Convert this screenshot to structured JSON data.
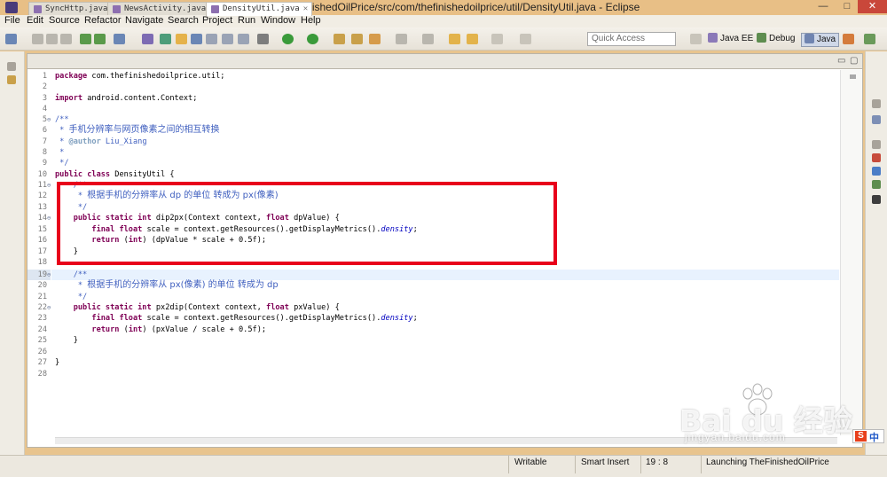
{
  "window": {
    "title": "Java - TheFinishedOilPrice/src/com/thefinishedoilprice/util/DensityUtil.java - Eclipse"
  },
  "menu": [
    "File",
    "Edit",
    "Source",
    "Refactor",
    "Navigate",
    "Search",
    "Project",
    "Run",
    "Window",
    "Help"
  ],
  "toolbar": {
    "quick_access_placeholder": "Quick Access",
    "perspectives": [
      "Java EE",
      "Debug",
      "Java"
    ]
  },
  "tabs": [
    {
      "label": "SyncHttp.java",
      "active": false
    },
    {
      "label": "NewsActivity.java",
      "active": false
    },
    {
      "label": "DensityUtil.java",
      "active": true
    }
  ],
  "code": [
    {
      "n": "1",
      "text": "package com.thefinishedoilprice.util;"
    },
    {
      "n": "2",
      "text": ""
    },
    {
      "n": "3",
      "text": "import android.content.Context;"
    },
    {
      "n": "4",
      "text": ""
    },
    {
      "n": "5",
      "text": "/**"
    },
    {
      "n": "6",
      "text": " * 手机分辨率与网页像素之间的相互转换"
    },
    {
      "n": "7",
      "text": " * @author Liu_Xiang"
    },
    {
      "n": "8",
      "text": " *"
    },
    {
      "n": "9",
      "text": " */"
    },
    {
      "n": "10",
      "text": "public class DensityUtil {"
    },
    {
      "n": "11",
      "text": "    /**"
    },
    {
      "n": "12",
      "text": "     * 根据手机的分辨率从 dp 的单位 转成为 px(像素)"
    },
    {
      "n": "13",
      "text": "     */"
    },
    {
      "n": "14",
      "text": "    public static int dip2px(Context context, float dpValue) {"
    },
    {
      "n": "15",
      "text": "        final float scale = context.getResources().getDisplayMetrics().density;"
    },
    {
      "n": "16",
      "text": "        return (int) (dpValue * scale + 0.5f);"
    },
    {
      "n": "17",
      "text": "    }"
    },
    {
      "n": "18",
      "text": ""
    },
    {
      "n": "19",
      "text": "    /**"
    },
    {
      "n": "20",
      "text": "     * 根据手机的分辨率从 px(像素) 的单位 转成为 dp"
    },
    {
      "n": "21",
      "text": "     */"
    },
    {
      "n": "22",
      "text": "    public static int px2dip(Context context, float pxValue) {"
    },
    {
      "n": "23",
      "text": "        final float scale = context.getResources().getDisplayMetrics().density;"
    },
    {
      "n": "24",
      "text": "        return (int) (pxValue / scale + 0.5f);"
    },
    {
      "n": "25",
      "text": "    }"
    },
    {
      "n": "26",
      "text": ""
    },
    {
      "n": "27",
      "text": "}"
    },
    {
      "n": "28",
      "text": ""
    }
  ],
  "status": {
    "writable": "Writable",
    "insert_mode": "Smart Insert",
    "position": "19 : 8",
    "job": "Launching TheFinishedOilPrice"
  },
  "watermark": {
    "logo": "Bai du 经验",
    "url": "jingyan.baidu.com"
  },
  "ime": {
    "s": "S",
    "lang": "中"
  },
  "colors": {
    "highlight_box": "#e8001b",
    "keyword": "#7f0055",
    "comment": "#3f5fbf"
  }
}
